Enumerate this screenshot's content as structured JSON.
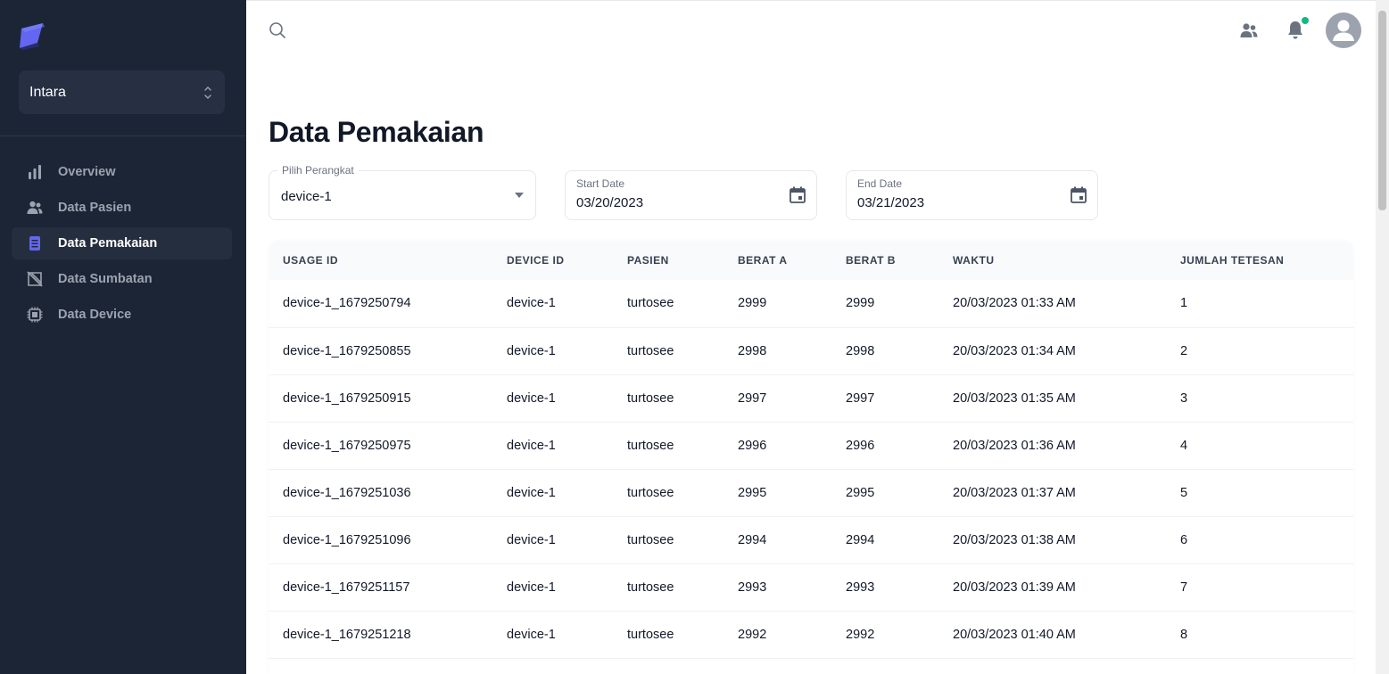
{
  "sidebar": {
    "org_name": "Intara",
    "items": [
      {
        "label": "Overview",
        "icon": "bar-chart-icon",
        "active": false
      },
      {
        "label": "Data Pasien",
        "icon": "users-icon",
        "active": false
      },
      {
        "label": "Data Pemakaian",
        "icon": "document-icon",
        "active": true
      },
      {
        "label": "Data Sumbatan",
        "icon": "blocked-icon",
        "active": false
      },
      {
        "label": "Data Device",
        "icon": "chip-icon",
        "active": false
      }
    ]
  },
  "topbar": {
    "icons": [
      "search-icon",
      "users-icon",
      "bell-icon",
      "avatar-icon"
    ],
    "notification_dot_color": "#10b981"
  },
  "main": {
    "title": "Data Pemakaian",
    "device_select": {
      "label": "Pilih Perangkat",
      "value": "device-1"
    },
    "start_date": {
      "label": "Start Date",
      "value": "03/20/2023"
    },
    "end_date": {
      "label": "End Date",
      "value": "03/21/2023"
    }
  },
  "table": {
    "columns": [
      "Usage ID",
      "Device ID",
      "Pasien",
      "Berat A",
      "Berat B",
      "Waktu",
      "Jumlah Tetesan"
    ],
    "rows": [
      [
        "device-1_1679250794",
        "device-1",
        "turtosee",
        "2999",
        "2999",
        "20/03/2023 01:33 AM",
        "1"
      ],
      [
        "device-1_1679250855",
        "device-1",
        "turtosee",
        "2998",
        "2998",
        "20/03/2023 01:34 AM",
        "2"
      ],
      [
        "device-1_1679250915",
        "device-1",
        "turtosee",
        "2997",
        "2997",
        "20/03/2023 01:35 AM",
        "3"
      ],
      [
        "device-1_1679250975",
        "device-1",
        "turtosee",
        "2996",
        "2996",
        "20/03/2023 01:36 AM",
        "4"
      ],
      [
        "device-1_1679251036",
        "device-1",
        "turtosee",
        "2995",
        "2995",
        "20/03/2023 01:37 AM",
        "5"
      ],
      [
        "device-1_1679251096",
        "device-1",
        "turtosee",
        "2994",
        "2994",
        "20/03/2023 01:38 AM",
        "6"
      ],
      [
        "device-1_1679251157",
        "device-1",
        "turtosee",
        "2993",
        "2993",
        "20/03/2023 01:39 AM",
        "7"
      ],
      [
        "device-1_1679251218",
        "device-1",
        "turtosee",
        "2992",
        "2992",
        "20/03/2023 01:40 AM",
        "8"
      ]
    ]
  },
  "colors": {
    "sidebar_bg": "#1c2536",
    "accent": "#6366f1",
    "text_primary": "#111827"
  }
}
